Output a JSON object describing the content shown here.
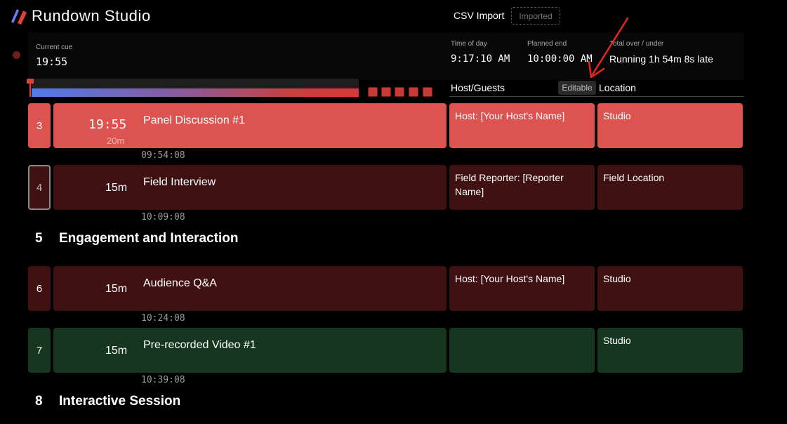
{
  "app": {
    "title": "Rundown Studio"
  },
  "csv": {
    "label": "CSV Import",
    "badge": "Imported"
  },
  "clocks": {
    "current_cue_label": "Current cue",
    "current_cue_value": "19:55",
    "time_of_day_label": "Time of day",
    "time_of_day_value": "9:17:10 AM",
    "planned_end_label": "Planned end",
    "planned_end_value": "10:00:00 AM",
    "over_under_label": "Total over / under",
    "over_under_value": "Running 1h 54m 8s late"
  },
  "columns": {
    "host": "Host/Guests",
    "editable_badge": "Editable",
    "location": "Location"
  },
  "cues": [
    {
      "number": "3",
      "countdown": "19:55",
      "duration": "20m",
      "title": "Panel Discussion #1",
      "host": "Host: [Your Host's Name]",
      "location": "Studio",
      "start_time": "09:54:08"
    },
    {
      "number": "4",
      "duration": "15m",
      "title": "Field Interview",
      "host": "Field Reporter: [Reporter Name]",
      "location": "Field Location",
      "start_time": "10:09:08"
    },
    {
      "number": "6",
      "duration": "15m",
      "title": "Audience Q&A",
      "host": "Host: [Your Host's Name]",
      "location": "Studio",
      "start_time": "10:24:08"
    },
    {
      "number": "7",
      "duration": "15m",
      "title": "Pre-recorded Video #1",
      "host": "",
      "location": "Studio",
      "start_time": "10:39:08"
    }
  ],
  "sections": [
    {
      "number": "5",
      "title": "Engagement and Interaction"
    },
    {
      "number": "8",
      "title": "Interactive Session"
    }
  ],
  "colors": {
    "active": "#dd5350",
    "dark_red": "#3f1112",
    "green": "#173620",
    "annotation": "#e8261f"
  }
}
